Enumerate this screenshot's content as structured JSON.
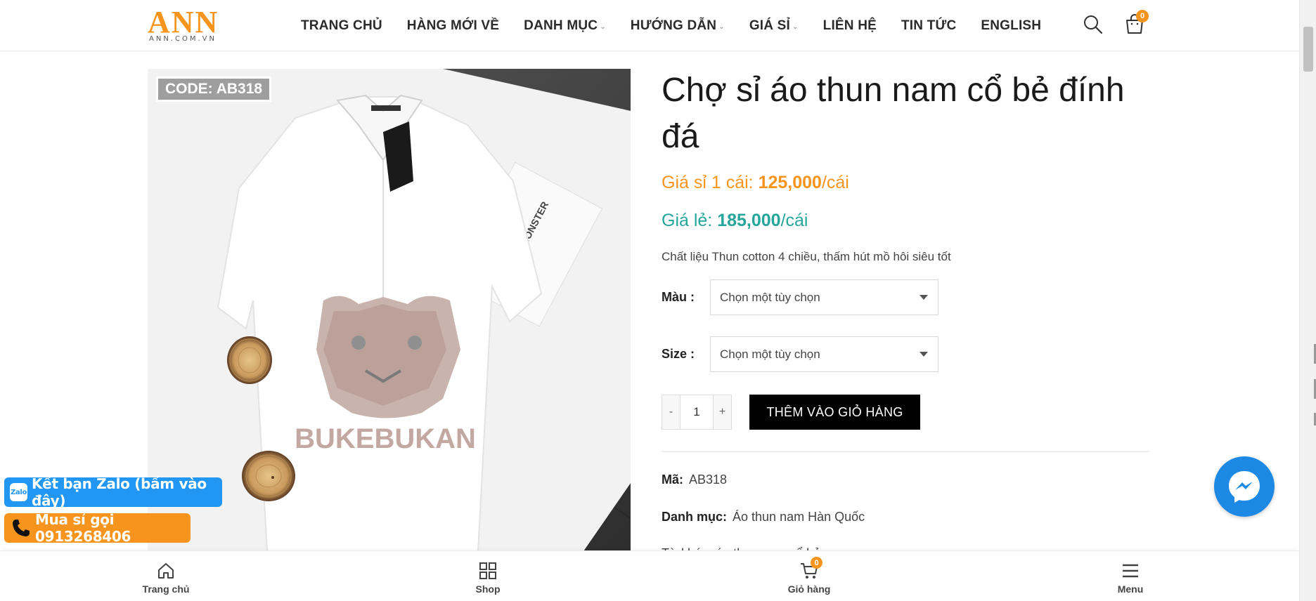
{
  "header": {
    "logo_text": "ANN",
    "logo_sub": "ANN.COM.VN",
    "nav": [
      {
        "label": "TRANG CHỦ",
        "has_dropdown": false
      },
      {
        "label": "HÀNG MỚI VỀ",
        "has_dropdown": false
      },
      {
        "label": "DANH MỤC",
        "has_dropdown": true
      },
      {
        "label": "HƯỚNG DẪN",
        "has_dropdown": true
      },
      {
        "label": "GIÁ SỈ",
        "has_dropdown": true
      },
      {
        "label": "LIÊN HỆ",
        "has_dropdown": false
      },
      {
        "label": "TIN TỨC",
        "has_dropdown": false
      },
      {
        "label": "ENGLISH",
        "has_dropdown": false
      }
    ],
    "cart_count": "0",
    "icons": {
      "search": "search-icon",
      "cart": "shopping-bag-icon"
    }
  },
  "product": {
    "image_code": "CODE: AB318",
    "image_brand_box": "GENTLE MONSTER",
    "image_shirt_text": "BUKEBUKAN",
    "title": "Chợ sỉ áo thun nam cổ bẻ đính đá",
    "wholesale_label": "Giá sỉ 1 cái: ",
    "wholesale_price": "125,000",
    "wholesale_unit": "/cái",
    "retail_label": "Giá lẻ: ",
    "retail_price": "185,000",
    "retail_unit": "/cái",
    "description": "Chất liệu Thun cotton 4 chiều, thấm hút mồ hôi siêu tốt",
    "color_label": "Màu :",
    "color_value": "Chọn một tùy chọn",
    "size_label": "Size :",
    "size_value": "Chọn một tùy chọn",
    "qty_minus": "-",
    "qty_value": "1",
    "qty_plus": "+",
    "add_to_cart": "THÊM VÀO GIỎ HÀNG",
    "sku_label": "Mã:",
    "sku_value": "AB318",
    "category_label": "Danh mục:",
    "category_value": "Áo thun nam Hàn Quốc",
    "tags_partial": "Từ khóa: áo thun nam cổ bẻ"
  },
  "floating": {
    "zalo_icon_text": "Zalo",
    "zalo_label": "Kết bạn Zalo (bấm vào đây)",
    "call_label": "Mua sỉ gọi 0913268406"
  },
  "bottom_bar": {
    "items": [
      {
        "label": "Trang chủ",
        "icon": "home-icon"
      },
      {
        "label": "Shop",
        "icon": "grid-icon"
      },
      {
        "label": "Giỏ hàng",
        "icon": "cart-icon",
        "badge": "0"
      },
      {
        "label": "Menu",
        "icon": "menu-icon"
      }
    ]
  },
  "colors": {
    "brand_orange": "#f7941d",
    "retail_teal": "#26a69a",
    "zalo_blue": "#2196f3",
    "messenger_blue": "#1e88e5"
  }
}
